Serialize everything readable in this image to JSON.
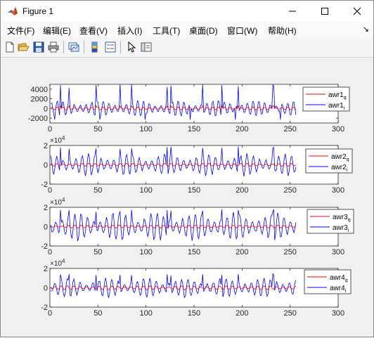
{
  "window": {
    "title": "Figure 1",
    "controls": {
      "minimize": "minimize",
      "maximize": "maximize",
      "close": "close"
    }
  },
  "menubar": {
    "items": [
      {
        "label": "文件(F)"
      },
      {
        "label": "编辑(E)"
      },
      {
        "label": "查看(V)"
      },
      {
        "label": "插入(I)"
      },
      {
        "label": "工具(T)"
      },
      {
        "label": "桌面(D)"
      },
      {
        "label": "窗口(W)"
      },
      {
        "label": "帮助(H)"
      }
    ],
    "dock_arrow": "↘"
  },
  "toolbar": {
    "buttons": [
      "new-figure",
      "open-file",
      "save",
      "print",
      "link-plot",
      "insert-colorbar",
      "insert-legend",
      "edit-plot",
      "property-inspector"
    ]
  },
  "colors": {
    "series_q": "#ff0000",
    "series_i": "#0000ff",
    "axes": "#262626"
  },
  "chart_data": [
    {
      "type": "line",
      "xlim": [
        0,
        300
      ],
      "ylim": [
        -3000,
        5000
      ],
      "xticks": [
        "0",
        "50",
        "100",
        "150",
        "200",
        "250",
        "300"
      ],
      "yticks": [
        "-2000",
        "0",
        "2000",
        "4000"
      ],
      "exponent": "",
      "legend_position": "top-right",
      "series": [
        {
          "name": "awr1",
          "sub": "q",
          "color": "#ff0000",
          "amplitude": 300,
          "peak": 600,
          "period": 6,
          "x_range": [
            1,
            256
          ]
        },
        {
          "name": "awr1",
          "sub": "i",
          "color": "#0000ff",
          "amplitude": 1500,
          "peak": 5000,
          "trough": -2300,
          "period": 6,
          "x_range": [
            1,
            256
          ]
        }
      ]
    },
    {
      "type": "line",
      "xlim": [
        0,
        300
      ],
      "ylim": [
        -2,
        2
      ],
      "xticks": [
        "0",
        "50",
        "100",
        "150",
        "200",
        "250",
        "300"
      ],
      "yticks": [
        "-2",
        "0",
        "2"
      ],
      "exponent": "4",
      "legend_position": "top-right",
      "series": [
        {
          "name": "awr2",
          "sub": "q",
          "color": "#ff0000",
          "amplitude": 0.15,
          "period": 6.6,
          "x_range": [
            1,
            256
          ]
        },
        {
          "name": "awr2",
          "sub": "i",
          "color": "#0000ff",
          "amplitude": 1.0,
          "peak": 1.9,
          "period": 6.6,
          "x_range": [
            1,
            256
          ]
        }
      ]
    },
    {
      "type": "line",
      "xlim": [
        0,
        300
      ],
      "ylim": [
        -2,
        2
      ],
      "xticks": [
        "0",
        "50",
        "100",
        "150",
        "200",
        "250",
        "300"
      ],
      "yticks": [
        "-2",
        "0",
        "2"
      ],
      "exponent": "4",
      "legend_position": "top-right",
      "series": [
        {
          "name": "awr3",
          "sub": "q",
          "color": "#ff0000",
          "amplitude": 0.15,
          "period": 6.6,
          "x_range": [
            1,
            256
          ]
        },
        {
          "name": "awr3",
          "sub": "i",
          "color": "#0000ff",
          "amplitude": 1.3,
          "peak": 1.8,
          "period": 6.6,
          "x_range": [
            1,
            256
          ]
        }
      ]
    },
    {
      "type": "line",
      "xlim": [
        0,
        300
      ],
      "ylim": [
        -2,
        2
      ],
      "xticks": [
        "0",
        "50",
        "100",
        "150",
        "200",
        "250",
        "300"
      ],
      "yticks": [
        "-2",
        "0",
        "2"
      ],
      "exponent": "4",
      "legend_position": "top-right",
      "series": [
        {
          "name": "awr4",
          "sub": "q",
          "color": "#ff0000",
          "amplitude": 0.2,
          "period": 6.6,
          "x_range": [
            1,
            256
          ]
        },
        {
          "name": "awr4",
          "sub": "i",
          "color": "#0000ff",
          "amplitude": 0.9,
          "peak": 1.5,
          "period": 6.6,
          "x_range": [
            1,
            256
          ]
        }
      ]
    }
  ]
}
